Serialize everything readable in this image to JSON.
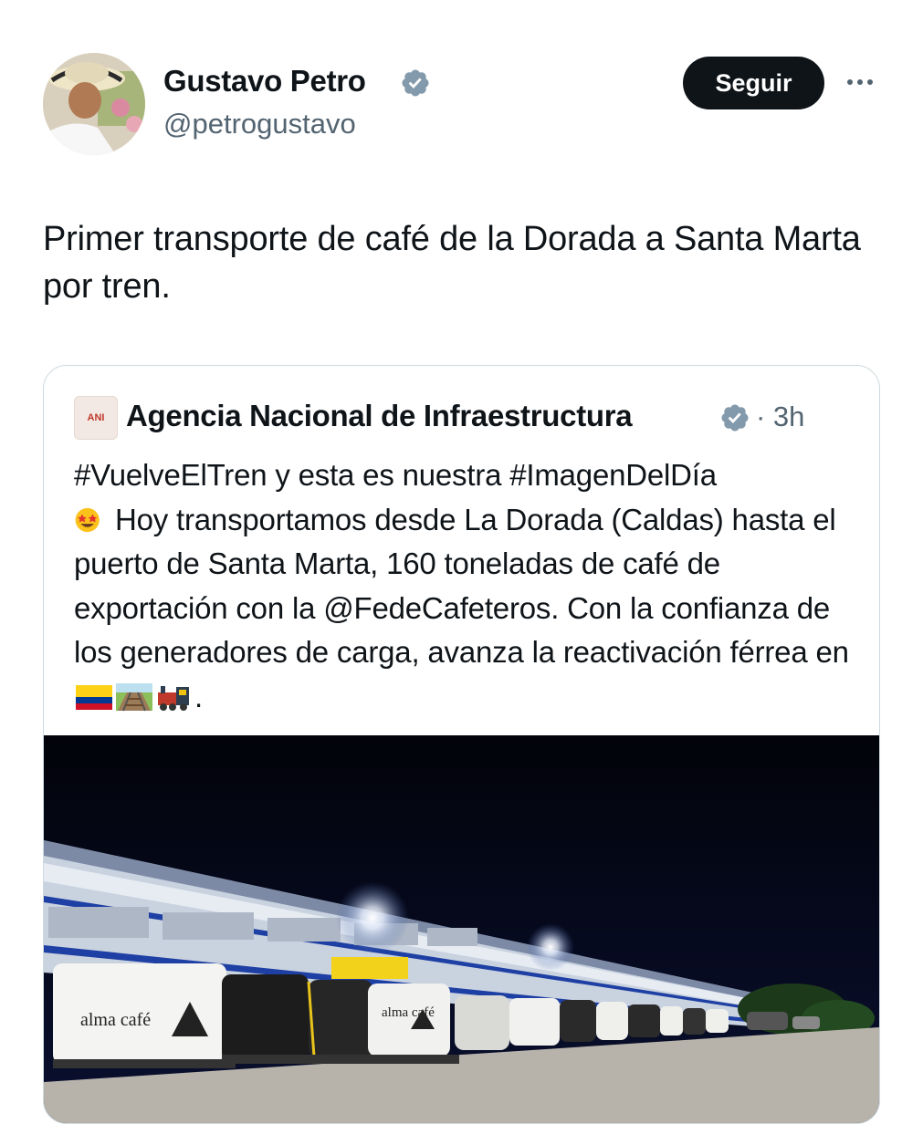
{
  "tweet": {
    "author": {
      "name": "Gustavo Petro",
      "handle": "@petrogustavo"
    },
    "follow_label": "Seguir",
    "text": "Primer transporte de café de la Dorada a Santa Marta por tren."
  },
  "quoted": {
    "author_name": "Agencia Nacional de Infraestructura",
    "time": "· 3h",
    "text_line1": "#VuelveElTren y esta es nuestra #ImagenDelDía",
    "text_body": " Hoy transportamos desde La Dorada (Caldas) hasta el puerto de Santa Marta, 160 toneladas de café de exportación con la @FedeCafeteros. Con la confianza de los generadores de carga, avanza la reactivación férrea en",
    "text_end": ".",
    "logo_text": "ANI",
    "photo_signs": [
      "alma café",
      "alma café"
    ],
    "emoji": [
      "star-struck",
      "colombia-flag",
      "railway-track",
      "locomotive"
    ]
  },
  "colors": {
    "text": "#0f1419",
    "secondary": "#536471",
    "verified": "#829aab",
    "border": "#cfd9de"
  }
}
